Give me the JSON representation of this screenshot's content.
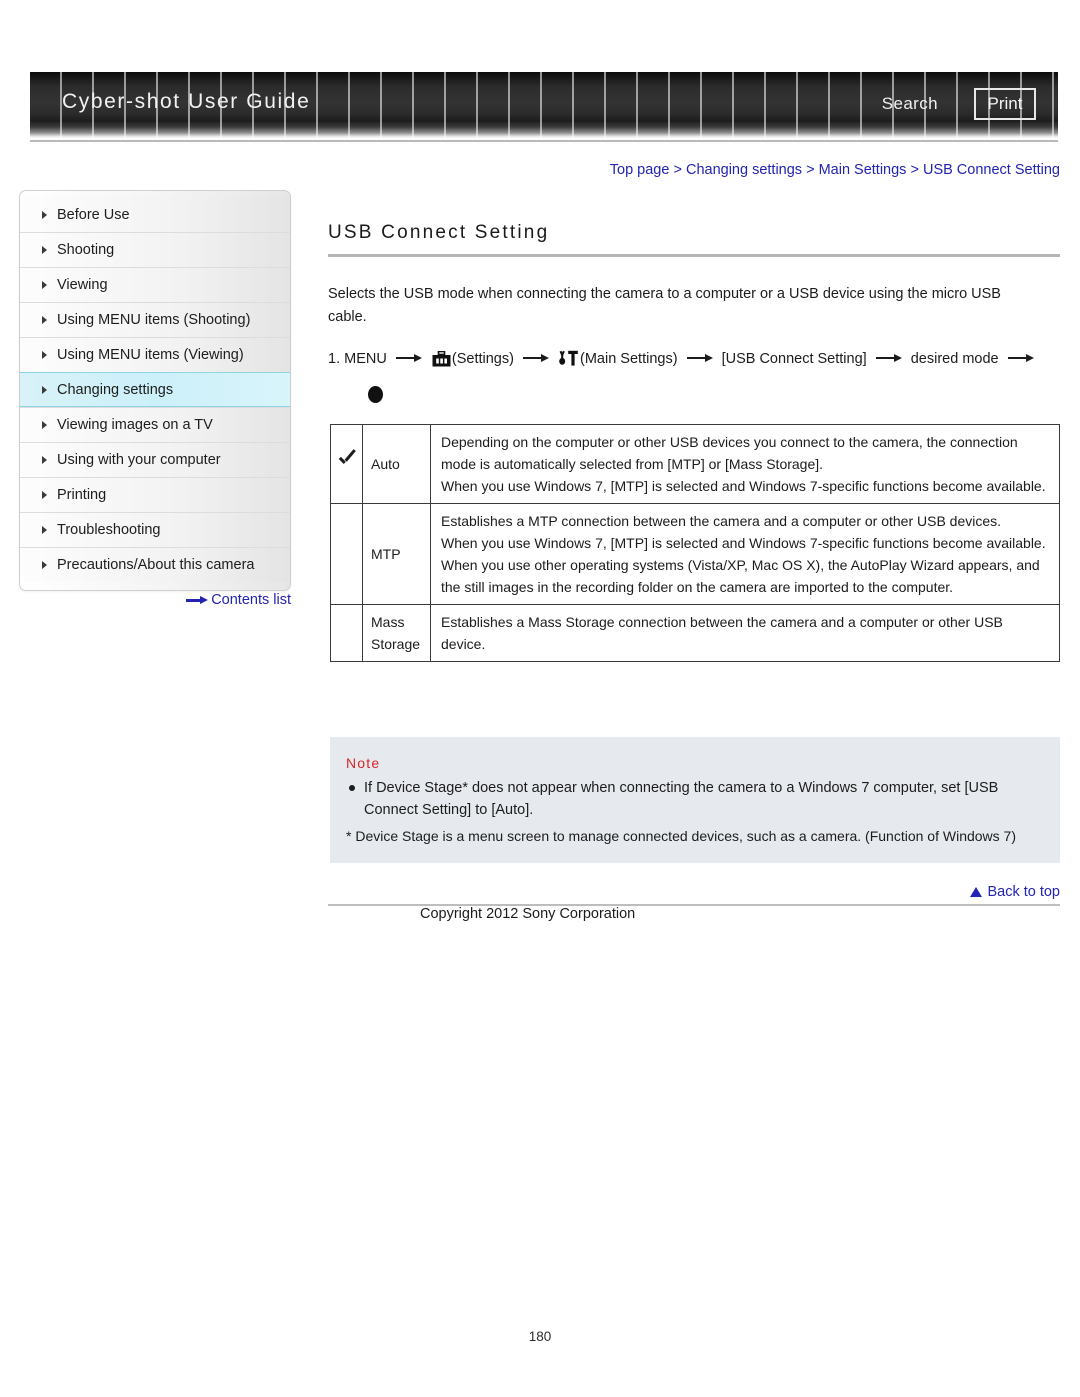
{
  "header": {
    "title": "Cyber-shot User Guide",
    "search_label": "Search",
    "print_label": "Print"
  },
  "breadcrumb": {
    "separator": " > ",
    "items": [
      {
        "label": "Top page"
      },
      {
        "label": "Changing settings"
      },
      {
        "label": "Main Settings"
      },
      {
        "label": "USB Connect Setting"
      }
    ]
  },
  "sidebar": {
    "items": [
      {
        "label": "Before Use",
        "active": false
      },
      {
        "label": "Shooting",
        "active": false
      },
      {
        "label": "Viewing",
        "active": false
      },
      {
        "label": "Using MENU items (Shooting)",
        "active": false
      },
      {
        "label": "Using MENU items (Viewing)",
        "active": false
      },
      {
        "label": "Changing settings",
        "active": true
      },
      {
        "label": "Viewing images on a TV",
        "active": false
      },
      {
        "label": "Using with your computer",
        "active": false
      },
      {
        "label": "Printing",
        "active": false
      },
      {
        "label": "Troubleshooting",
        "active": false
      },
      {
        "label": "Precautions/About this camera",
        "active": false
      }
    ],
    "contents_list_label": "Contents list"
  },
  "main": {
    "page_title": "USB Connect Setting",
    "intro": "Selects the USB mode when connecting the camera to a computer or a USB device using the micro USB cable.",
    "step": {
      "number": "1.",
      "start": "MENU",
      "settings_label": "(Settings)",
      "main_settings_label": "(Main Settings)",
      "bracket_item": "[USB Connect Setting]",
      "end": "desired mode"
    },
    "table": {
      "rows": [
        {
          "checked": true,
          "label": "Auto",
          "description": "Depending on the computer or other USB devices you connect to the camera, the connection mode is automatically selected from [MTP] or [Mass Storage].\nWhen you use Windows 7, [MTP] is selected and Windows 7-specific functions become available."
        },
        {
          "checked": false,
          "label": "MTP",
          "description": "Establishes a MTP connection between the camera and a computer or other USB devices.\nWhen you use Windows 7, [MTP] is selected and Windows 7-specific functions become available.\nWhen you use other operating systems (Vista/XP, Mac OS X), the AutoPlay Wizard appears, and the still images in the recording folder on the camera are imported to the computer."
        },
        {
          "checked": false,
          "label": "Mass Storage",
          "description": "Establishes a Mass Storage connection between the camera and a computer or other USB device."
        }
      ]
    },
    "note": {
      "heading": "Note",
      "bullets": [
        "If Device Stage* does not appear when connecting the camera to a Windows 7 computer, set [USB Connect Setting] to [Auto]."
      ],
      "footnote": "* Device Stage is a menu screen to manage connected devices, such as a camera. (Function of Windows 7)"
    }
  },
  "footer": {
    "back_to_top_label": "Back to top",
    "copyright": "Copyright 2012 Sony Corporation",
    "page_number": "180"
  },
  "colors": {
    "link": "#2323b4",
    "note_heading": "#d6262b",
    "active_nav": "#ccf0fa",
    "note_bg": "#e6eaee"
  }
}
